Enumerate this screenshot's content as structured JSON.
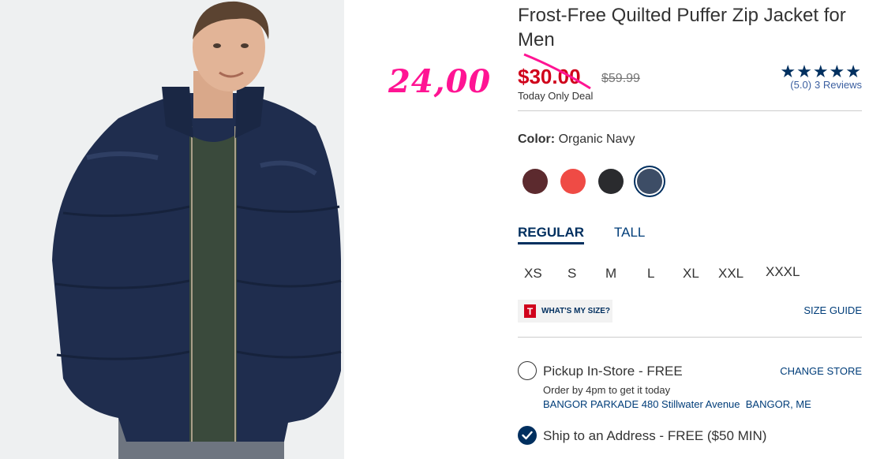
{
  "image": {
    "alt": "Man wearing a navy quilted puffer jacket"
  },
  "annotation": {
    "text": "24,00",
    "color": "#ff1493"
  },
  "product": {
    "title": "Frost-Free Quilted Puffer Zip Jacket for Men",
    "sale_price": "$30.00",
    "original_price": "$59.99",
    "deal_label": "Today Only Deal",
    "rating": {
      "stars": "★★★★★",
      "score": "(5.0)",
      "reviews": "3 Reviews"
    }
  },
  "color": {
    "label": "Color:",
    "value": "Organic Navy",
    "swatches": [
      {
        "name": "burgundy",
        "hex": "#5c2a2e"
      },
      {
        "name": "coral",
        "hex": "#ef4b45"
      },
      {
        "name": "black",
        "hex": "#2a2b2e"
      },
      {
        "name": "organic navy",
        "hex": "#3d4d66",
        "selected": true
      }
    ]
  },
  "fit_tabs": [
    {
      "label": "REGULAR",
      "active": true
    },
    {
      "label": "TALL",
      "active": false
    }
  ],
  "sizes": [
    "XS",
    "S",
    "M",
    "L",
    "XL",
    "XXL",
    "XXXL"
  ],
  "whats_my_size": {
    "icon_letter": "T",
    "label": "WHAT'S MY SIZE?"
  },
  "size_guide": "SIZE GUIDE",
  "pickup": {
    "label": "Pickup In-Store - FREE",
    "change_store": "CHANGE STORE",
    "note": "Order by 4pm to get it today",
    "store": "BANGOR PARKADE 480 Stillwater Avenue  BANGOR, ME"
  },
  "ship": {
    "label": "Ship to an Address - FREE ($50 MIN)"
  },
  "colors": {
    "sale_red": "#d0021b",
    "navy": "#002f5f",
    "link_blue": "#003d79",
    "annotation_pink": "#ff1493"
  }
}
